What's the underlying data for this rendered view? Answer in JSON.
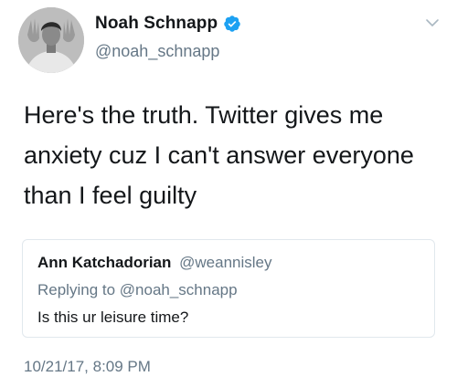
{
  "author": {
    "display_name": "Noah Schnapp",
    "handle": "@noah_schnapp",
    "verified": true,
    "avatar_icon": "profile-photo-avatar"
  },
  "menu": {
    "icon": "chevron-down-icon"
  },
  "tweet": {
    "text": "Here's the truth. Twitter gives me anxiety cuz I can't answer everyone than I feel guilty",
    "timestamp": "10/21/17, 8:09 PM"
  },
  "quoted_tweet": {
    "name": "Ann Katchadorian",
    "handle": "@weannisley",
    "replying_to": "Replying to @noah_schnapp",
    "text": "Is this ur leisure time?"
  },
  "colors": {
    "primary_text": "#14171a",
    "secondary_text": "#657786",
    "verified_badge": "#1da1f2",
    "border": "#e1e8ed"
  }
}
